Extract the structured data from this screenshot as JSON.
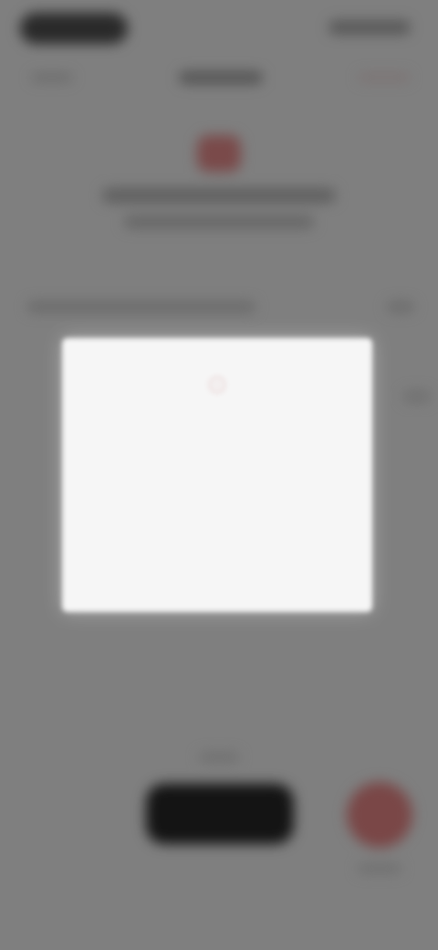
{
  "theme": {
    "overlay": "#808080",
    "modal_bg": "#f6f6f6",
    "accent": "#7a4747",
    "primary_button": "#141414"
  },
  "modal": {
    "icon_name": "info-icon",
    "title": "",
    "body": "",
    "link_primary": "",
    "link_secondary": "",
    "footer": ""
  }
}
